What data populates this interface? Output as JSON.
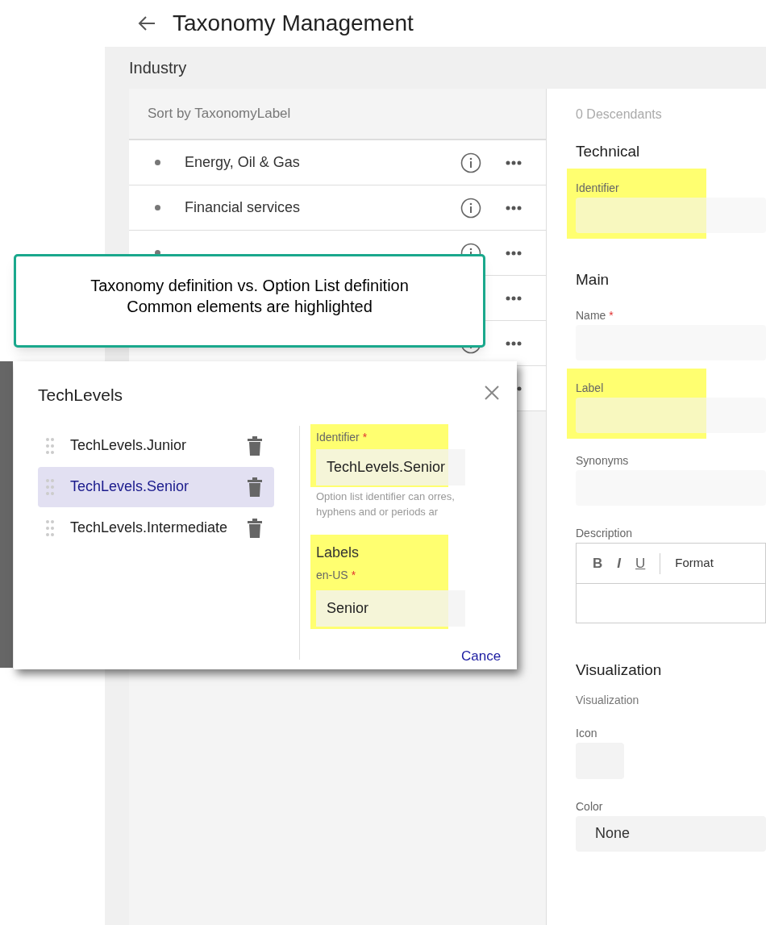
{
  "header": {
    "title": "Taxonomy Management"
  },
  "section_title": "Industry",
  "tree": {
    "sort_label": "Sort by TaxonomyLabel",
    "rows": [
      {
        "label": "Energy, Oil & Gas"
      },
      {
        "label": "Financial services"
      },
      {},
      {},
      {},
      {}
    ]
  },
  "details": {
    "descendants": "0 Descendants",
    "sections": [
      {
        "title": "Technical",
        "fields": [
          {
            "kind": "input",
            "label": "Identifier",
            "highlighted": true
          }
        ]
      },
      {
        "title": "Main",
        "fields": [
          {
            "kind": "input",
            "label": "Name",
            "required_mark": "*",
            "highlighted": false
          },
          {
            "kind": "input",
            "label": "Label",
            "highlighted": true
          },
          {
            "kind": "input",
            "label": "Synonyms",
            "highlighted": false
          },
          {
            "kind": "editor",
            "label": "Description",
            "highlighted": false,
            "toolbar": [
              "B",
              "I",
              "U"
            ],
            "format": "Format"
          }
        ]
      },
      {
        "title": "Visualization",
        "fields": [
          {
            "kind": "caption",
            "label": "Visualization"
          },
          {
            "kind": "icon",
            "label": "Icon",
            "highlighted": false
          },
          {
            "kind": "select",
            "label": "Color",
            "highlighted": false,
            "value": "None"
          }
        ]
      }
    ]
  },
  "callout": {
    "lines": [
      "Taxonomy definition vs. Option List definition",
      "Common elements are highlighted"
    ]
  },
  "dialog": {
    "title": "TechLevels",
    "options": [
      {
        "label": "TechLevels.Junior",
        "selected": false
      },
      {
        "label": "TechLevels.Senior",
        "selected": true
      },
      {
        "label": "TechLevels.Intermediate",
        "selected": false
      }
    ],
    "identifier": {
      "label": "Identifier",
      "required_mark": "*",
      "value": "TechLevels.Senior",
      "highlighted": true,
      "hint": "Option list identifier can orres, hyphens and or periods ar"
    },
    "labels": {
      "title": "Labels",
      "locale": "en-US",
      "required_mark": "*",
      "value": "Senior",
      "highlighted": true
    },
    "cancel": "Cance"
  }
}
